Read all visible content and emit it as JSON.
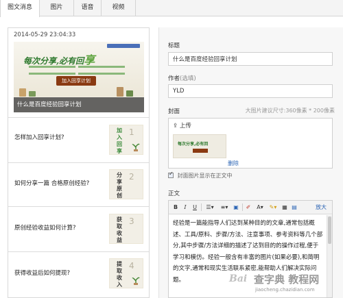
{
  "tabs": [
    {
      "label": "图文消息",
      "active": true
    },
    {
      "label": "图片",
      "active": false
    },
    {
      "label": "语音",
      "active": false
    },
    {
      "label": "视频",
      "active": false
    }
  ],
  "cover_card": {
    "timestamp": "2014-05-29 23:04:33",
    "banner_slogan_prefix": "每次分享,必有回",
    "banner_slogan_big": "享",
    "banner_button": "加入回享计划",
    "caption": "什么是百度经验回享计划"
  },
  "articles": [
    {
      "title": "怎样加入回享计划?",
      "thumb_word": "加入回享",
      "thumb_num": "1"
    },
    {
      "title": "如何分享一篇 合格原创经验?",
      "thumb_word": "分享原创",
      "thumb_num": "2"
    },
    {
      "title": "原创经验收益如何计算?",
      "thumb_word": "获取收益",
      "thumb_num": "3"
    },
    {
      "title": "获得收益后如何提现?",
      "thumb_word": "提取收入",
      "thumb_num": "4"
    }
  ],
  "form": {
    "title_label": "标题",
    "title_value": "什么是百度经验回享计划",
    "author_label": "作者",
    "author_hint": "(选填)",
    "author_value": "YLD",
    "cover_label": "封面",
    "cover_hint": "大图片建议尺寸:360像素 * 200像素",
    "upload_label": "上传",
    "delete_label": "删除",
    "show_cover_label": "封面图片显示在正文中",
    "body_label": "正文",
    "body_text": "经验是一篇能指导人们达到某种目的的文章,通常包括概述、工具/原料、步骤/方法、注意事项、参考资料等几个部分,其中步骤/方法详细的描述了达到目的的操作过程,便于学习和模仿。经验一般含有丰富的图片(如果必要),和简明的文字,通常和现实生活联系紧密,能帮助人们解决实际问题。"
  },
  "toolbar": {
    "bold": "B",
    "italic": "I",
    "underline": "U",
    "list": "☰▾",
    "align": "≡▾",
    "image": "▣",
    "link": "✐",
    "font": "A▾",
    "color": "✎▾",
    "grid": "▦",
    "table": "▤",
    "fullscreen": "放大"
  },
  "watermark": {
    "logo": "Bai",
    "text": "查字典 教程网",
    "url": "jiaocheng.chazidian.com"
  },
  "colors": {
    "link": "#2b64b4",
    "banner_green": "#2f7a2f",
    "banner_button": "#8a3a12"
  }
}
